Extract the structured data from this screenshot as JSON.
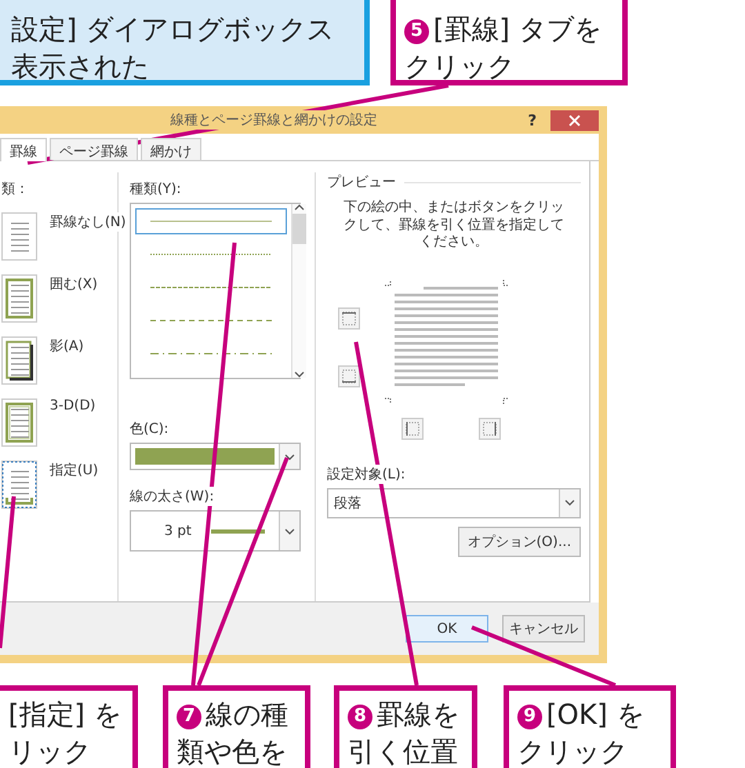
{
  "top_callouts": [
    {
      "kind": "note",
      "lines": [
        "設定] ダイアログボックス",
        "表示された"
      ]
    },
    {
      "kind": "step",
      "badge": "5",
      "lines": [
        "[罫線] タブを",
        "クリック"
      ]
    }
  ],
  "dialog": {
    "title": "線種とページ罫線と網かけの設定",
    "help": "?",
    "tabs": [
      {
        "label": "罫線",
        "selected": true
      },
      {
        "label": "ページ罫線",
        "selected": false
      },
      {
        "label": "網かけ",
        "selected": false
      }
    ],
    "setting": {
      "label": "類：",
      "options": [
        {
          "kind": "none",
          "label": "罫線なし(N)",
          "selected": false
        },
        {
          "kind": "box",
          "label": "囲む(X)",
          "selected": false
        },
        {
          "kind": "shadow",
          "label": "影(A)",
          "selected": false
        },
        {
          "kind": "three-d",
          "label": "3-D(D)",
          "selected": false
        },
        {
          "kind": "custom",
          "label": "指定(U)",
          "selected": true
        }
      ]
    },
    "style": {
      "label": "種類(Y):",
      "line_styles": [
        {
          "kind": "solid",
          "selected": true
        },
        {
          "kind": "dotted",
          "selected": false
        },
        {
          "kind": "dashed",
          "selected": false
        },
        {
          "kind": "long-dashed",
          "selected": false
        },
        {
          "kind": "dash-dot",
          "selected": false
        }
      ]
    },
    "color": {
      "label": "色(C):",
      "color": "#8fa352"
    },
    "width": {
      "label": "線の太さ(W):",
      "value": "3 pt"
    },
    "preview": {
      "label": "プレビュー",
      "hint": "下の絵の中、またはボタンをクリックして、罫線を引く位置を指定してください。"
    },
    "apply_to": {
      "label": "設定対象(L):",
      "value": "段落"
    },
    "options_button": "オプション(O)...",
    "buttons": [
      {
        "label": "OK",
        "default": true
      },
      {
        "label": "キャンセル",
        "default": false
      }
    ]
  },
  "bottom_callouts": [
    {
      "kind": "step",
      "lines": [
        "[指定] を",
        "リック"
      ]
    },
    {
      "kind": "step",
      "badge": "7",
      "lines": [
        "線の種",
        "類や色を"
      ]
    },
    {
      "kind": "step",
      "badge": "8",
      "lines": [
        "罫線を",
        "引く位置"
      ]
    },
    {
      "kind": "step",
      "badge": "9",
      "lines": [
        "[OK] を",
        "クリック"
      ]
    }
  ]
}
